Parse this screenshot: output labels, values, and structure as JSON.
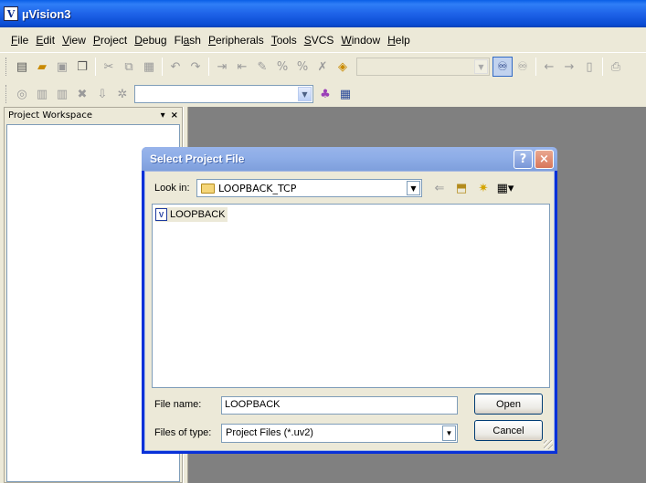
{
  "app": {
    "title": "µVision3",
    "icon_letter": "V"
  },
  "menu": [
    "File",
    "Edit",
    "View",
    "Project",
    "Debug",
    "Flash",
    "Peripherals",
    "Tools",
    "SVCS",
    "Window",
    "Help"
  ],
  "menu_underline": [
    "F",
    "E",
    "V",
    "P",
    "D",
    "a",
    "P",
    "T",
    "S",
    "W",
    "H"
  ],
  "toolbar2": {
    "build_target_combo": ""
  },
  "workspace": {
    "title": "Project Workspace",
    "pin": "▾",
    "close": "×"
  },
  "dialog": {
    "title": "Select Project File",
    "help_button": "?",
    "close_button": "×",
    "look_in_label": "Look in:",
    "look_in_value": "LOOPBACK_TCP",
    "files": [
      {
        "name": "LOOPBACK",
        "icon": "uv2-project-file-icon"
      }
    ],
    "file_name_label": "File name:",
    "file_name_value": "LOOPBACK",
    "files_of_type_label": "Files of type:",
    "files_of_type_value": "Project Files (*.uv2)",
    "open_button": "Open",
    "cancel_button": "Cancel"
  }
}
